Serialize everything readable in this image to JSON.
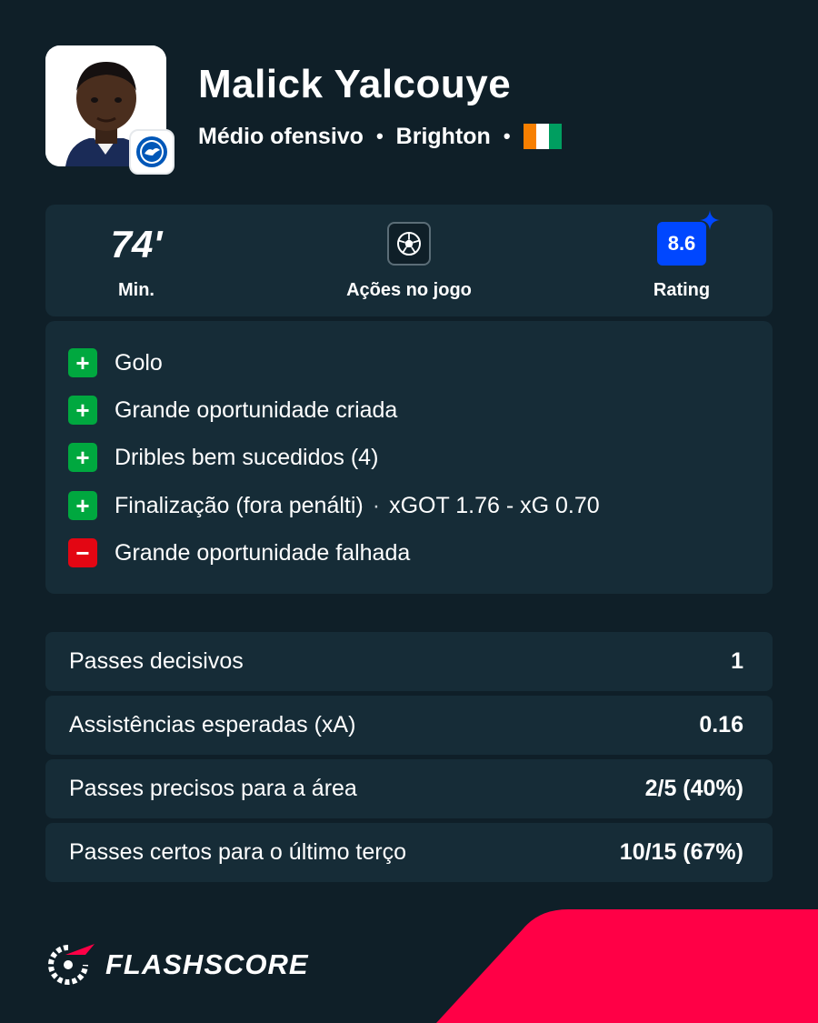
{
  "player": {
    "name": "Malick Yalcouye",
    "position": "Médio ofensivo",
    "team": "Brighton",
    "separator": "•",
    "flag_colors": [
      "#f77f00",
      "#ffffff",
      "#009e60"
    ]
  },
  "summary": {
    "minutes_value": "74'",
    "minutes_label": "Min.",
    "actions_label": "Ações no jogo",
    "actions_icon": "football-icon",
    "rating_value": "8.6",
    "rating_label": "Rating",
    "rating_color": "#0047ff"
  },
  "actions": [
    {
      "sign": "+",
      "type": "positive",
      "text": "Golo"
    },
    {
      "sign": "+",
      "type": "positive",
      "text": "Grande oportunidade criada"
    },
    {
      "sign": "+",
      "type": "positive",
      "text": "Dribles bem sucedidos (4)"
    },
    {
      "sign": "+",
      "type": "positive",
      "text": "Finalização (fora penálti)",
      "separator": "·",
      "detail": "xGOT 1.76 - xG 0.70"
    },
    {
      "sign": "−",
      "type": "negative",
      "text": "Grande oportunidade falhada"
    }
  ],
  "stats": [
    {
      "label": "Passes decisivos",
      "value": "1"
    },
    {
      "label": "Assistências esperadas (xA)",
      "value": "0.16"
    },
    {
      "label": "Passes precisos para a área",
      "value": "2/5 (40%)"
    },
    {
      "label": "Passes certos para o último terço",
      "value": "10/15 (67%)"
    }
  ],
  "brand": {
    "name": "FLASHSCORE",
    "accent_color": "#ff0046"
  },
  "colors": {
    "background": "#0f1f28",
    "panel": "#162c37",
    "positive": "#00a83f",
    "negative": "#e30613"
  }
}
